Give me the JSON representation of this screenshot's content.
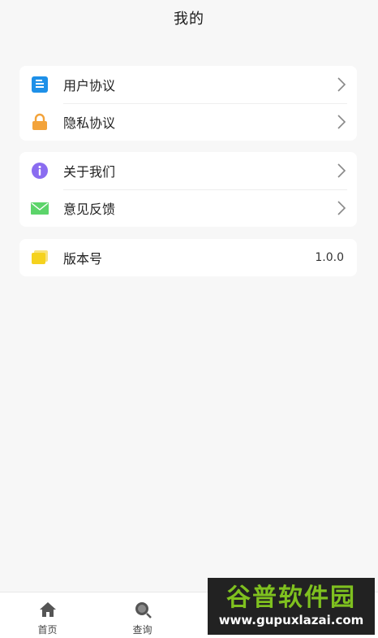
{
  "header": {
    "title": "我的"
  },
  "menu": {
    "group1": [
      {
        "label": "用户协议",
        "icon": "document-icon"
      },
      {
        "label": "隐私协议",
        "icon": "lock-icon"
      }
    ],
    "group2": [
      {
        "label": "关于我们",
        "icon": "info-icon"
      },
      {
        "label": "意见反馈",
        "icon": "mail-icon"
      }
    ],
    "group3": [
      {
        "label": "版本号",
        "icon": "folder-icon",
        "value": "1.0.0"
      }
    ]
  },
  "tabbar": {
    "items": [
      {
        "label": "首页",
        "icon": "home-icon"
      },
      {
        "label": "查询",
        "icon": "search-icon"
      }
    ]
  },
  "watermark": {
    "title": "谷普软件园",
    "url": "www.gupuxlazai.com"
  },
  "colors": {
    "document": "#1e90e8",
    "lock": "#f3a33a",
    "info": "#8a6cf0",
    "mail": "#5cd46a",
    "folder": "#f5d21e",
    "watermark_green": "#7fc11f"
  }
}
